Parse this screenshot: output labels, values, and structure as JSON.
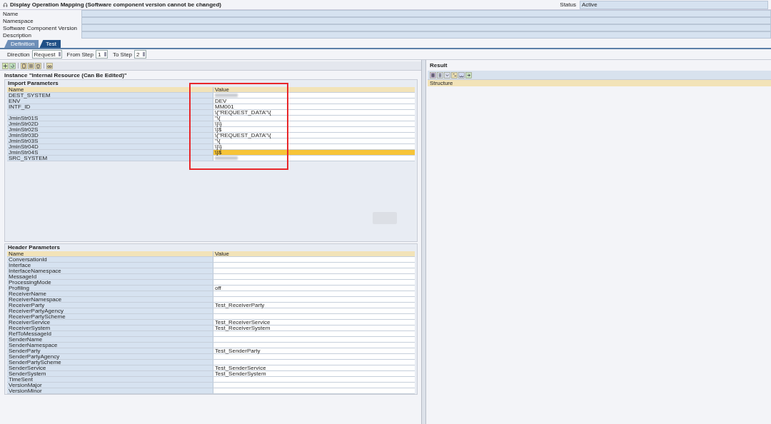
{
  "window": {
    "title": "Display Operation Mapping (Software component version cannot be changed)"
  },
  "fields": [
    {
      "label": "Name"
    },
    {
      "label": "Namespace"
    },
    {
      "label": "Software Component Version"
    },
    {
      "label": "Description"
    }
  ],
  "status": {
    "label": "Status",
    "value": "Active"
  },
  "tabs": [
    {
      "label": "Definition",
      "selected": false
    },
    {
      "label": "Test",
      "selected": true
    }
  ],
  "step_bar": {
    "direction_label": "Direction",
    "direction": "Request",
    "from_label": "From Step",
    "from": "1",
    "to_label": "To Step",
    "to": "2"
  },
  "instance_title": "Instance \"Internal Resource (Can Be Edited)\"",
  "import_parameters": {
    "title": "Import Parameters",
    "columns": [
      "Name",
      "Value"
    ],
    "highlight_value_column": true,
    "rows": [
      {
        "name": "DEST_SYSTEM",
        "redacted": true,
        "selected": false
      },
      {
        "name": "ENV",
        "value": "DEV",
        "selected": false
      },
      {
        "name": "INTF_ID",
        "value": "MM001",
        "selected": false
      },
      {
        "value": "\\{\"REQUEST_DATA\"\\{",
        "selected": false
      },
      {
        "name": "JminStr01S",
        "value": "\"\\{",
        "selected": false
      },
      {
        "name": "JminStr02D",
        "value": "\\}\\}",
        "selected": false
      },
      {
        "name": "JminStr02S",
        "value": "\\}$",
        "selected": false
      },
      {
        "name": "JminStr03D",
        "value": "\\{\"REQUEST_DATA\"\\{",
        "selected": false
      },
      {
        "name": "JminStr03S",
        "value": "\"\\{",
        "selected": false
      },
      {
        "name": "JminStr04D",
        "value": "\\}\\}",
        "selected": false
      },
      {
        "name": "JminStr04S",
        "value": "\\}$",
        "selected": true
      },
      {
        "name": "SRC_SYSTEM",
        "redacted": true,
        "selected": false
      }
    ]
  },
  "header_parameters": {
    "title": "Header Parameters",
    "columns": [
      "Name",
      "Value"
    ],
    "rows": [
      {
        "name": "ConversationId"
      },
      {
        "name": "Interface"
      },
      {
        "name": "InterfaceNamespace"
      },
      {
        "name": "MessageId"
      },
      {
        "name": "ProcessingMode"
      },
      {
        "name": "Profiling",
        "value": "off"
      },
      {
        "name": "ReceiverName"
      },
      {
        "name": "ReceiverNamespace"
      },
      {
        "name": "ReceiverParty",
        "value": "Test_ReceiverParty"
      },
      {
        "name": "ReceiverPartyAgency"
      },
      {
        "name": "ReceiverPartyScheme"
      },
      {
        "name": "ReceiverService",
        "value": "Test_ReceiverService"
      },
      {
        "name": "ReceiverSystem",
        "value": "Test_ReceiverSystem"
      },
      {
        "name": "RefToMessageId"
      },
      {
        "name": "SenderName"
      },
      {
        "name": "SenderNamespace"
      },
      {
        "name": "SenderParty",
        "value": "Test_SenderParty"
      },
      {
        "name": "SenderPartyAgency"
      },
      {
        "name": "SenderPartyScheme"
      },
      {
        "name": "SenderService",
        "value": "Test_SenderService"
      },
      {
        "name": "SenderSystem",
        "value": "Test_SenderSystem"
      },
      {
        "name": "TimeSent"
      },
      {
        "name": "VersionMajor"
      },
      {
        "name": "VersionMinor"
      }
    ]
  },
  "result": {
    "title": "Result",
    "column": "Structure"
  }
}
